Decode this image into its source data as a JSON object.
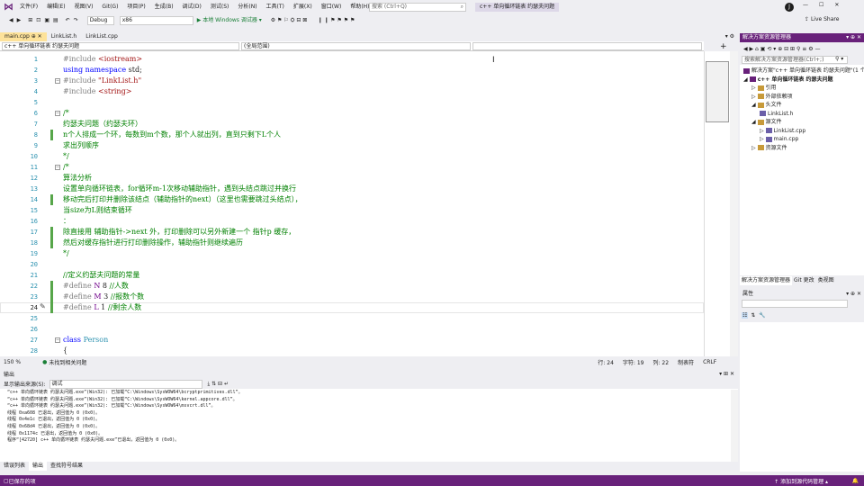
{
  "colors": {
    "accent": "#68217a",
    "active_tab": "#fde29a",
    "modified_gutter": "#57a64a"
  },
  "menu": {
    "items": [
      "文件(F)",
      "编辑(E)",
      "视图(V)",
      "Git(G)",
      "项目(P)",
      "生成(B)",
      "调试(D)",
      "测试(S)",
      "分析(N)",
      "工具(T)",
      "扩展(X)",
      "窗口(W)",
      "帮助(H)"
    ],
    "search_placeholder": "搜索 (Ctrl+Q)",
    "solution_title": "c++ 单向循环链表 约瑟夫问题",
    "avatar": "J"
  },
  "toolbar": {
    "config": "Debug",
    "platform": "x86",
    "run_label": "▶ 本地 Windows 调试器 ▾",
    "live_share": "Live Share"
  },
  "tabs": [
    {
      "label": "main.cpp",
      "pin": "⊕ ✕",
      "active": true
    },
    {
      "label": "LinkList.h",
      "active": false
    },
    {
      "label": "LinkList.cpp",
      "active": false
    }
  ],
  "navbar": {
    "project": "c++ 单向循环链表 约瑟夫问题",
    "scope": "(全局范围)"
  },
  "editor": {
    "lines": [
      {
        "n": "1",
        "t": [
          [
            "pp",
            "#include "
          ],
          [
            "str",
            "<iostream>"
          ]
        ]
      },
      {
        "n": "2",
        "t": [
          [
            "kw",
            "using namespace "
          ],
          [
            "txt",
            "std;"
          ]
        ]
      },
      {
        "n": "3",
        "t": [
          [
            "pp",
            "#include "
          ],
          [
            "str",
            "\"LinkList.h\""
          ]
        ],
        "fold": "−"
      },
      {
        "n": "4",
        "t": [
          [
            "pp",
            "#include "
          ],
          [
            "str",
            "<string>"
          ]
        ]
      },
      {
        "n": "5",
        "t": []
      },
      {
        "n": "6",
        "t": [
          [
            "com",
            "/*"
          ]
        ],
        "fold": "−"
      },
      {
        "n": "7",
        "t": [
          [
            "com",
            "约瑟夫问题（约瑟夫环）"
          ]
        ]
      },
      {
        "n": "8",
        "t": [
          [
            "com",
            "n个人排成一个环，每数到m个数，那个人就出列，直到只剩下L个人"
          ]
        ],
        "mod": true
      },
      {
        "n": "9",
        "t": [
          [
            "com",
            "求出列顺序"
          ]
        ]
      },
      {
        "n": "10",
        "t": [
          [
            "com",
            "*/"
          ]
        ]
      },
      {
        "n": "11",
        "t": [
          [
            "com",
            "/*"
          ]
        ],
        "fold": "−"
      },
      {
        "n": "12",
        "t": [
          [
            "com",
            "算法分析"
          ]
        ]
      },
      {
        "n": "13",
        "t": [
          [
            "com",
            "设置单向循环链表，for循环m-1次移动辅助指针，遇到头结点跳过并换行"
          ]
        ]
      },
      {
        "n": "14",
        "t": [
          [
            "com",
            "移动完后打印并删除该结点（辅助指针的next）（这里也需要跳过头结点），"
          ]
        ],
        "mod": true
      },
      {
        "n": "15",
        "t": [
          [
            "com",
            "当size为L则结束循环"
          ]
        ]
      },
      {
        "n": "16",
        "t": [
          [
            "com",
            "："
          ]
        ]
      },
      {
        "n": "17",
        "t": [
          [
            "com",
            "除直接用 辅助指针->next 外，打印删除可以另外新建一个 指针p 缓存，"
          ]
        ],
        "mod": true
      },
      {
        "n": "18",
        "t": [
          [
            "com",
            "然后对缓存指针进行打印删除操作，辅助指针则继续遍历"
          ]
        ],
        "mod": true
      },
      {
        "n": "19",
        "t": [
          [
            "com",
            "*/"
          ]
        ]
      },
      {
        "n": "20",
        "t": []
      },
      {
        "n": "21",
        "t": [
          [
            "com",
            "//定义约瑟夫问题的常量"
          ]
        ]
      },
      {
        "n": "22",
        "t": [
          [
            "pp",
            "#define "
          ],
          [
            "mac",
            "N"
          ],
          [
            "txt",
            " 8 "
          ],
          [
            "com",
            "//人数"
          ]
        ],
        "mod": true
      },
      {
        "n": "23",
        "t": [
          [
            "pp",
            "#define "
          ],
          [
            "mac",
            "M"
          ],
          [
            "txt",
            " 3 "
          ],
          [
            "com",
            "//报数个数"
          ]
        ],
        "mod": true
      },
      {
        "n": "24",
        "t": [
          [
            "pp",
            "#define "
          ],
          [
            "mac",
            "L"
          ],
          [
            "txt",
            " 1 "
          ],
          [
            "com",
            "//剩余人数"
          ]
        ],
        "mod": true,
        "current": true
      },
      {
        "n": "25",
        "t": []
      },
      {
        "n": "26",
        "t": []
      },
      {
        "n": "27",
        "t": [
          [
            "kw",
            "class "
          ],
          [
            "cls",
            "Person"
          ]
        ],
        "fold": "−"
      },
      {
        "n": "28",
        "t": [
          [
            "txt",
            "{"
          ]
        ]
      }
    ]
  },
  "editor_status": {
    "zoom": "150 %",
    "issues": "未找到相关问题",
    "line": "行: 24",
    "col": "字符: 19",
    "space": "列: 22",
    "tabs": "制表符",
    "eol": "CRLF"
  },
  "output": {
    "title": "输出",
    "source_label": "显示输出来源(S):",
    "source_value": "调试",
    "lines": [
      "“c++ 单向循环链表 约瑟夫问题.exe”(Win32): 已加载“C:\\Windows\\SysWOW64\\bcryptprimitives.dll”。",
      "“c++ 单向循环链表 约瑟夫问题.exe”(Win32): 已加载“C:\\Windows\\SysWOW64\\kernel.appcore.dll”。",
      "“c++ 单向循环链表 约瑟夫问题.exe”(Win32): 已加载“C:\\Windows\\SysWOW64\\msvcrt.dll”。",
      "线程 0xa608 已退出，返回值为 0 (0x0)。",
      "线程 0x4e1c 已退出，返回值为 0 (0x0)。",
      "线程 0x68d4 已退出，返回值为 0 (0x0)。",
      "线程 0x1174c 已退出，返回值为 0 (0x0)。",
      "程序“[42720] c++ 单向循环链表 约瑟夫问题.exe”已退出，返回值为 0 (0x0)。"
    ]
  },
  "bottom_tabs": [
    "错误列表",
    "输出",
    "查找符号结果"
  ],
  "statusbar": {
    "left": "已保存的项",
    "right": "↑ 添加到源代码管理 ▴"
  },
  "solution_explorer": {
    "title": "解决方案资源管理器",
    "search_placeholder": "搜索解决方案资源管理器(Ctrl+;)",
    "nodes": [
      {
        "label": "解决方案\"c++ 单向循环链表 约瑟夫问题\"(1 个项目/共 1 个)",
        "lvl": 0
      },
      {
        "label": "c++ 单向循环链表 约瑟夫问题",
        "lvl": 0,
        "sel": true
      },
      {
        "label": "引用",
        "lvl": 1
      },
      {
        "label": "外部依赖项",
        "lvl": 1
      },
      {
        "label": "头文件",
        "lvl": 1
      },
      {
        "label": "LinkList.h",
        "lvl": 2
      },
      {
        "label": "源文件",
        "lvl": 1
      },
      {
        "label": "LinkList.cpp",
        "lvl": 2
      },
      {
        "label": "main.cpp",
        "lvl": 2
      },
      {
        "label": "资源文件",
        "lvl": 1
      }
    ],
    "tabs": [
      "解决方案资源管理器",
      "Git 更改",
      "类视图"
    ]
  },
  "properties": {
    "title": "属性"
  }
}
